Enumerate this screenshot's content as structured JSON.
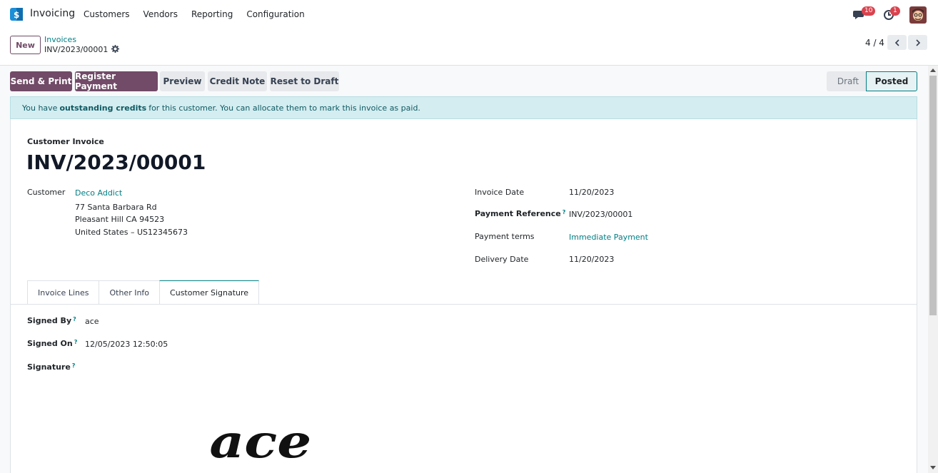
{
  "navbar": {
    "app_name": "Invoicing",
    "menu": [
      "Customers",
      "Vendors",
      "Reporting",
      "Configuration"
    ],
    "messages_badge": "10",
    "activities_badge": "1",
    "icons": [
      "invoicing-app-icon",
      "chat-icon",
      "clock-icon",
      "avatar"
    ]
  },
  "control": {
    "new_label": "New",
    "breadcrumb_parent": "Invoices",
    "breadcrumb_current": "INV/2023/00001",
    "pager": "4 / 4"
  },
  "actions": {
    "send_print": "Send & Print",
    "register_payment": "Register Payment",
    "preview": "Preview",
    "credit_note": "Credit Note",
    "reset_to_draft": "Reset to Draft"
  },
  "stages": {
    "draft": "Draft",
    "posted": "Posted",
    "current": "Posted"
  },
  "alert": {
    "prefix": "You have",
    "bold": "outstanding credits",
    "suffix": "for this customer. You can allocate them to mark this invoice as paid."
  },
  "invoice": {
    "type": "Customer Invoice",
    "name": "INV/2023/00001",
    "customer_label": "Customer",
    "customer_name": "Deco Addict",
    "address_line1": "77 Santa Barbara Rd",
    "address_line2": "Pleasant Hill CA 94523",
    "address_line3": "United States – US12345673",
    "invoice_date_label": "Invoice Date",
    "invoice_date": "11/20/2023",
    "payment_reference_label": "Payment Reference",
    "payment_reference": "INV/2023/00001",
    "payment_terms_label": "Payment terms",
    "payment_terms": "Immediate Payment",
    "delivery_date_label": "Delivery Date",
    "delivery_date": "11/20/2023",
    "help_mark": "?"
  },
  "tabs": [
    "Invoice Lines",
    "Other Info",
    "Customer Signature"
  ],
  "active_tab": "Customer Signature",
  "signature_tab": {
    "signed_by_label": "Signed By",
    "signed_by": "ace",
    "signed_on_label": "Signed On",
    "signed_on": "12/05/2023 12:50:05",
    "signature_label": "Signature",
    "signature_text": "ace"
  },
  "colors": {
    "primary": "#714b67",
    "link": "#017e84",
    "badge": "#d9434e",
    "alert_bg": "#d4edf0"
  }
}
